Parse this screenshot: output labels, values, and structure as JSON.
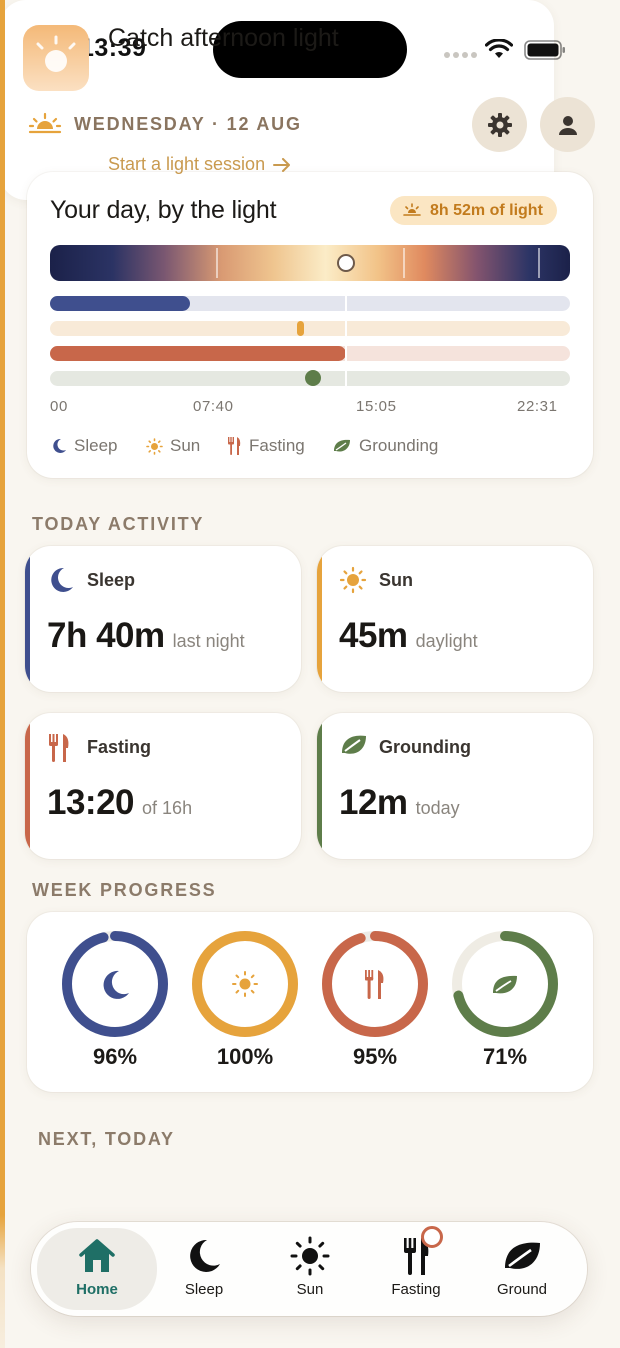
{
  "status": {
    "time": "13:39"
  },
  "header": {
    "date": "WEDNESDAY · 12 AUG"
  },
  "light_card": {
    "title": "Your day, by the light",
    "badge": "8h 52m of light",
    "times": [
      "00",
      "07:40",
      "15:05",
      "22:31"
    ],
    "tracks": {
      "sleep_fill": 0.27,
      "sun_marker": 0.48,
      "fasting_fill": 0.57,
      "grounding_marker": 0.505,
      "now": 0.57
    },
    "legend": [
      "Sleep",
      "Sun",
      "Fasting",
      "Grounding"
    ]
  },
  "today_label": "TODAY ACTIVITY",
  "activities": [
    {
      "name": "Sleep",
      "value": "7h 40m",
      "sub": "last night",
      "color": "#3f4f8e"
    },
    {
      "name": "Sun",
      "value": "45m",
      "sub": "daylight",
      "color": "#e6a33c"
    },
    {
      "name": "Fasting",
      "value": "13:20",
      "sub": "of 16h",
      "color": "#c8674a"
    },
    {
      "name": "Grounding",
      "value": "12m",
      "sub": "today",
      "color": "#5e7d4a"
    }
  ],
  "week_label": "WEEK PROGRESS",
  "week": [
    {
      "pct": "96%",
      "value": 0.96,
      "color": "#3f4f8e"
    },
    {
      "pct": "100%",
      "value": 1.0,
      "color": "#e6a33c"
    },
    {
      "pct": "95%",
      "value": 0.95,
      "color": "#c8674a"
    },
    {
      "pct": "71%",
      "value": 0.71,
      "color": "#5e7d4a"
    }
  ],
  "next_label": "NEXT, TODAY",
  "next": {
    "title": "Catch afternoon light",
    "cta": "Start a light session"
  },
  "tabs": [
    "Home",
    "Sleep",
    "Sun",
    "Fasting",
    "Ground"
  ]
}
